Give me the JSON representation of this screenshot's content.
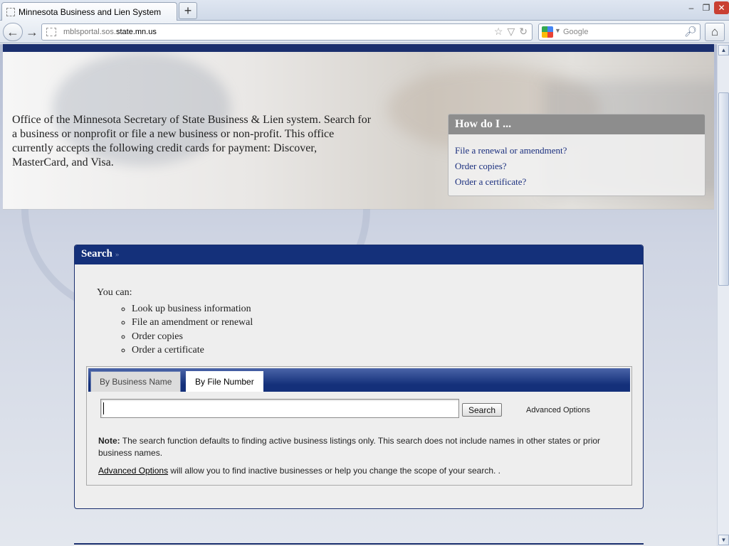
{
  "browser": {
    "tab_title": "Minnesota Business and Lien System",
    "new_tab_label": "+",
    "url_prefix": "mblsportal.sos.",
    "url_host": "state.mn.us",
    "search_engine": "Google",
    "window_controls": {
      "minimize": "–",
      "restore": "❐",
      "close": "✕"
    }
  },
  "hero": {
    "intro_text": "Office of the Minnesota Secretary of State Business & Lien system. Search for a business or nonprofit or file a new business or non-profit. This office currently accepts the following credit cards for payment: Discover, MasterCard, and Visa.",
    "how_title": "How do I ...",
    "how_links": [
      "File a renewal or amendment?",
      "Order copies?",
      "Order a certificate?"
    ]
  },
  "search_panel": {
    "title": "Search",
    "title_marker": "»",
    "you_can": "You can:",
    "options": [
      "Look up business information",
      "File an amendment or renewal",
      "Order copies",
      "Order a certificate"
    ],
    "tabs": [
      "By Business Name",
      "By File Number"
    ],
    "active_tab": "By File Number",
    "input_value": "",
    "search_button": "Search",
    "advanced_options_label": "Advanced Options",
    "note_label": "Note:",
    "note_text": " The search function defaults to finding active business listings only. This search does not include names in other states or prior business names.",
    "advanced_link": "Advanced Options",
    "advanced_text": " will allow you to find inactive businesses or help you change the scope of your search. ."
  },
  "colors": {
    "navy": "#14307a",
    "link": "#1a2f7e",
    "how_header": "#8d8d8d"
  }
}
